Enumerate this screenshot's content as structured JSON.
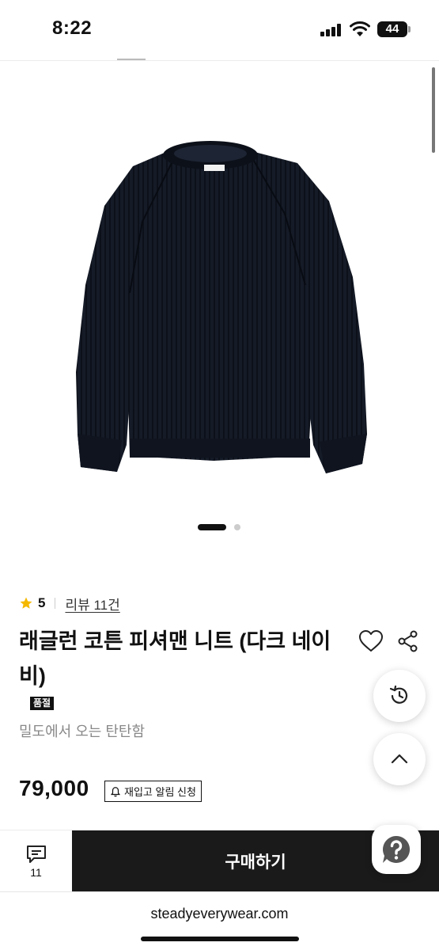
{
  "status_bar": {
    "time": "8:22",
    "battery": "44"
  },
  "carousel": {
    "image_alt": "dark navy raglan cotton fisherman knit sweater",
    "slides": 2,
    "active_slide": 1
  },
  "product": {
    "rating": "5",
    "review_link": "리뷰 11건",
    "title": "래글런 코튼 피셔맨 니트 (다크 네이비)",
    "badge": "품절",
    "subtitle": "밀도에서 오는 탄탄함",
    "price": "79,000",
    "restock_label": "재입고 알림 신청"
  },
  "bottom_bar": {
    "comment_count": "11",
    "buy_label": "구매하기"
  },
  "browser": {
    "url": "steadyeverywear.com"
  },
  "icons": {
    "star": "star-icon",
    "heart": "heart-icon",
    "share": "share-icon",
    "bell": "bell-icon",
    "history": "history-icon",
    "up": "chevron-up-icon",
    "comment": "comment-icon",
    "help": "help-icon"
  },
  "colors": {
    "star": "#F5B800",
    "buy_button": "#1a1a1a",
    "sweater": "#141a26"
  }
}
